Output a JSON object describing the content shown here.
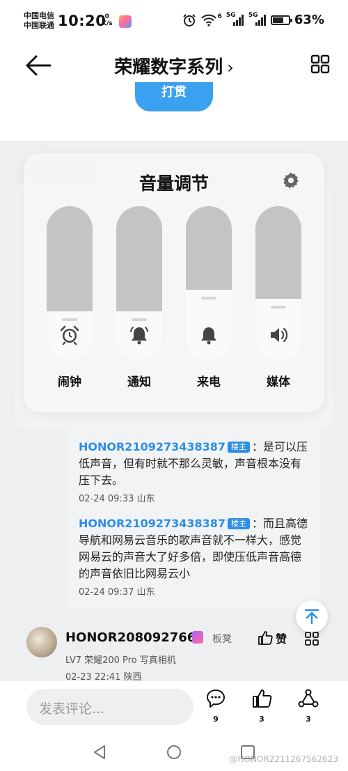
{
  "status_bar": {
    "carrier1": "中国电信",
    "carrier2": "中国联通",
    "time": "10:20",
    "speed_value": "0",
    "speed_unit": "K/s",
    "net_a": "6",
    "net_b": "5G",
    "net_c": "5G",
    "battery": "63%"
  },
  "header": {
    "title": "荣耀数字系列",
    "title_chevron": "›"
  },
  "sign_button": "打贯",
  "volume_panel": {
    "title": "音量调节",
    "sliders": [
      {
        "label": "闹钟",
        "icon": "alarm-clock-icon",
        "level": 0.32
      },
      {
        "label": "通知",
        "icon": "notification-bell-icon",
        "level": 0.32
      },
      {
        "label": "来电",
        "icon": "ringtone-bell-icon",
        "level": 0.46
      },
      {
        "label": "媒体",
        "icon": "speaker-icon",
        "level": 0.4
      }
    ]
  },
  "replies": [
    {
      "user": "HONOR2109273438387",
      "badge": "楼主",
      "text": "：是可以压低声音，但有时就不那么灵敏，声音根本没有压下去。",
      "meta": "02-24 09:33  山东"
    },
    {
      "user": "HONOR2109273438387",
      "badge": "楼主",
      "text": "：而且高德导航和网易云音乐的歌声音就不一样大，感觉网易云的声音大了好多倍，即使压低声音高德的声音依旧比网易云小",
      "meta": "02-24 09:37  山东"
    }
  ],
  "comment": {
    "user": "HONOR208092766",
    "seat": "板凳",
    "like_label": "赞",
    "level_device": "LV7   荣耀200 Pro 写真相机",
    "meta": "02-23 22:41    陕西"
  },
  "bottom_bar": {
    "placeholder": "发表评论...",
    "comment_count": "9",
    "like_count": "3",
    "share_count": "3"
  },
  "watermark": "@HONOR2211267562623",
  "colors": {
    "accent": "#2d8ee8",
    "sign_button": "#3aa0f0",
    "panel_bg": "#f6f6f6"
  }
}
